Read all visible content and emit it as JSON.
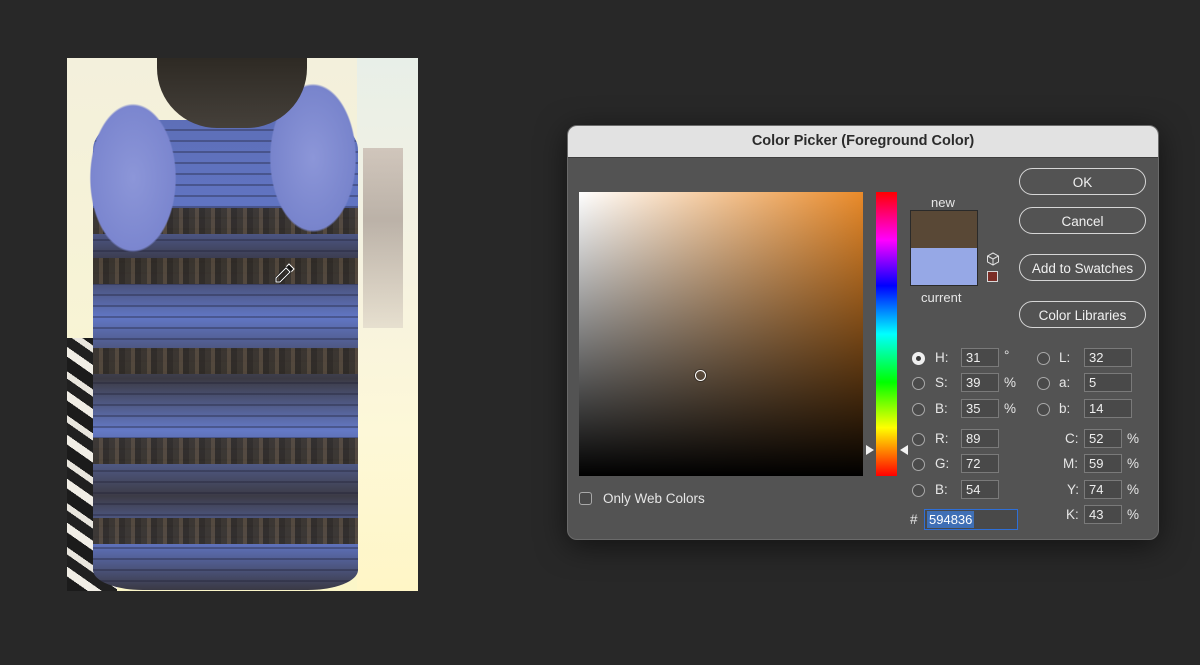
{
  "dialog": {
    "title": "Color Picker (Foreground Color)",
    "ok_label": "OK",
    "cancel_label": "Cancel",
    "add_to_swatches_label": "Add to Swatches",
    "color_libraries_label": "Color Libraries",
    "new_label": "new",
    "current_label": "current",
    "only_web_colors_label": "Only Web Colors",
    "only_web_colors_checked": false,
    "new_color": "#594836",
    "current_color": "#96a8e6",
    "hsb": {
      "h_label": "H:",
      "h_value": "31",
      "h_unit": "°",
      "s_label": "S:",
      "s_value": "39",
      "s_unit": "%",
      "b_label": "B:",
      "b_value": "35",
      "b_unit": "%"
    },
    "rgb": {
      "r_label": "R:",
      "r_value": "89",
      "g_label": "G:",
      "g_value": "72",
      "b_label": "B:",
      "b_value": "54"
    },
    "lab": {
      "l_label": "L:",
      "l_value": "32",
      "a_label": "a:",
      "a_value": "5",
      "b_label": "b:",
      "b_value": "14"
    },
    "cmyk": {
      "c_label": "C:",
      "c_value": "52",
      "c_unit": "%",
      "m_label": "M:",
      "m_value": "59",
      "m_unit": "%",
      "y_label": "Y:",
      "y_value": "74",
      "y_unit": "%",
      "k_label": "K:",
      "k_value": "43",
      "k_unit": "%"
    },
    "hex_sign": "#",
    "hex_value": "594836",
    "selected_channel": "H"
  },
  "icons": {
    "eyedropper": "eyedropper-icon",
    "cube": "web-safe-cube-icon",
    "gamut_warning": "gamut-warning-icon"
  }
}
